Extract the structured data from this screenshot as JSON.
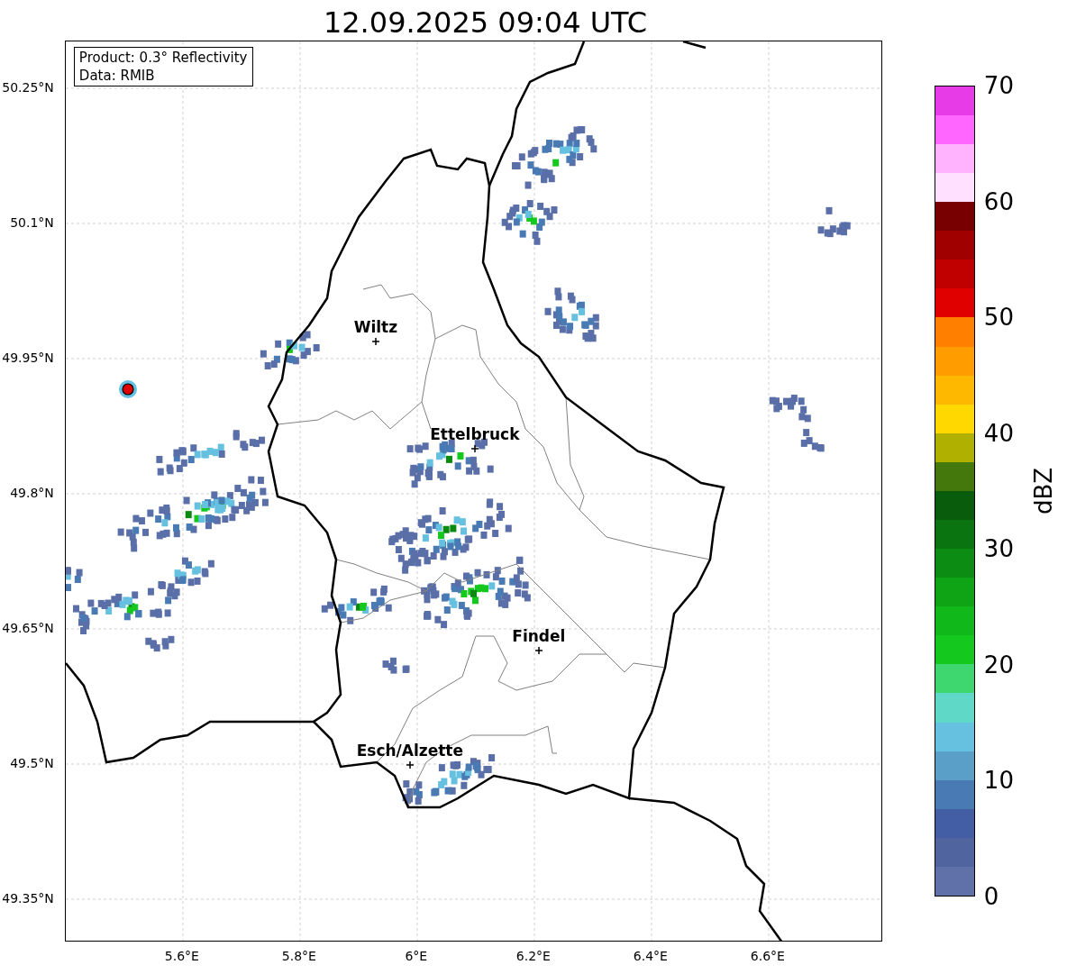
{
  "title": "12.09.2025 09:04 UTC",
  "info_box": {
    "lines": [
      "Product: 0.3° Reflectivity",
      "Data: RMIB"
    ]
  },
  "map": {
    "x_ticks": [
      "5.6°E",
      "5.8°E",
      "6°E",
      "6.2°E",
      "6.4°E",
      "6.6°E"
    ],
    "y_ticks": [
      "50.25°N",
      "50.1°N",
      "49.95°N",
      "49.8°N",
      "49.65°N",
      "49.5°N",
      "49.35°N"
    ],
    "cities": [
      {
        "name": "Wiltz"
      },
      {
        "name": "Ettelbruck"
      },
      {
        "name": "Findel"
      },
      {
        "name": "Esch/Alzette"
      }
    ]
  },
  "colorbar": {
    "label": "dBZ",
    "ticks": [
      "70",
      "60",
      "50",
      "40",
      "30",
      "20",
      "10",
      "0"
    ],
    "segments": [
      {
        "color": "#6070a8"
      },
      {
        "color": "#5064a0"
      },
      {
        "color": "#445ea6"
      },
      {
        "color": "#4a7ab4"
      },
      {
        "color": "#5a9fc8"
      },
      {
        "color": "#66c0e0"
      },
      {
        "color": "#60d8c8"
      },
      {
        "color": "#3ed66e"
      },
      {
        "color": "#14c81e"
      },
      {
        "color": "#10b81a"
      },
      {
        "color": "#0ea416"
      },
      {
        "color": "#0c8c12"
      },
      {
        "color": "#0a7410"
      },
      {
        "color": "#085c0c"
      },
      {
        "color": "#44780c"
      },
      {
        "color": "#b0b000"
      },
      {
        "color": "#ffd800"
      },
      {
        "color": "#ffb800"
      },
      {
        "color": "#ff9c00"
      },
      {
        "color": "#ff7f00"
      },
      {
        "color": "#e00000"
      },
      {
        "color": "#c00000"
      },
      {
        "color": "#a00000"
      },
      {
        "color": "#780000"
      },
      {
        "color": "#ffe0ff"
      },
      {
        "color": "#ffb3ff"
      },
      {
        "color": "#ff66ff"
      },
      {
        "color": "#e83be8"
      }
    ]
  }
}
